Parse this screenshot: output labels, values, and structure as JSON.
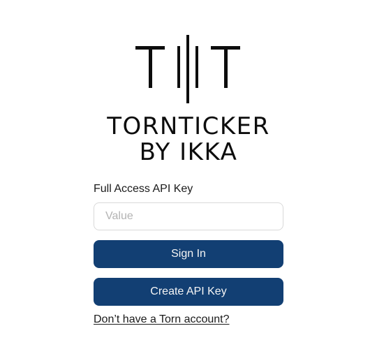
{
  "brand": {
    "line1": "TORNTICKER",
    "line2": "BY IKKA",
    "logo_icon": "tt-logo-icon"
  },
  "form": {
    "api_key_label": "Full Access API Key",
    "api_key_placeholder": "Value",
    "api_key_value": ""
  },
  "actions": {
    "sign_in_label": "Sign In",
    "create_key_label": "Create API Key",
    "signup_link_label": "Don’t have a Torn account?"
  },
  "colors": {
    "primary_button": "#123f73",
    "button_text": "#f5f5f5",
    "input_border": "#d9d9d9"
  }
}
